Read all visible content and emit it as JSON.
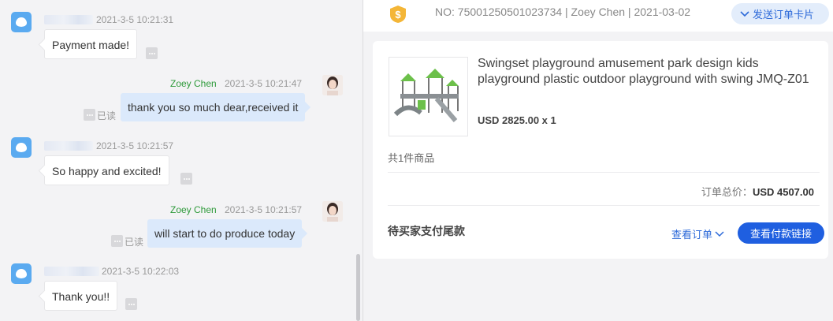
{
  "chat": {
    "messages": [
      {
        "direction": "in",
        "time": "2021-3-5 10:21:31",
        "text": "Payment made!"
      },
      {
        "direction": "out",
        "sender": "Zoey Chen",
        "time": "2021-3-5 10:21:47",
        "text": "thank you so much dear,received it",
        "status": "已读"
      },
      {
        "direction": "in",
        "time": "2021-3-5 10:21:57",
        "text": "So happy and excited!"
      },
      {
        "direction": "out",
        "sender": "Zoey Chen",
        "time": "2021-3-5 10:21:57",
        "text": "will start to do produce today",
        "status": "已读"
      },
      {
        "direction": "in",
        "time": "2021-3-5 10:22:03",
        "text": "Thank you!!"
      }
    ]
  },
  "order": {
    "meta": "NO: 75001250501023734 | Zoey Chen | 2021-03-02",
    "send_card_label": "发送订单卡片",
    "product_title": "Swingset playground amusement park design kids playground plastic outdoor playground with swing JMQ-Z01",
    "product_price": "USD 2825.00 x 1",
    "item_count": "共1件商品",
    "total_label": "订单总价：",
    "total_value": "USD 4507.00",
    "status": "待买家支付尾款",
    "view_order_label": "查看订单",
    "pay_link_label": "查看付款链接"
  },
  "colors": {
    "accent": "#1f5fe0",
    "sender_name": "#2e9a3a",
    "outgoing_bubble": "#dbe9fb"
  }
}
